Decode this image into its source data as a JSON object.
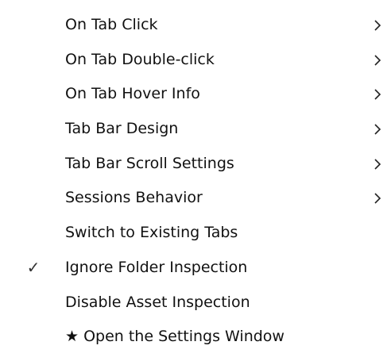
{
  "menu": {
    "items": [
      {
        "label": "On Tab Click",
        "submenu": true,
        "checked": false
      },
      {
        "label": "On Tab Double-click",
        "submenu": true,
        "checked": false
      },
      {
        "label": "On Tab Hover Info",
        "submenu": true,
        "checked": false
      },
      {
        "label": "Tab Bar Design",
        "submenu": true,
        "checked": false
      },
      {
        "label": "Tab Bar Scroll Settings",
        "submenu": true,
        "checked": false
      },
      {
        "label": "Sessions Behavior",
        "submenu": true,
        "checked": false
      },
      {
        "label": "Switch to Existing Tabs",
        "submenu": false,
        "checked": false
      },
      {
        "label": "Ignore Folder Inspection",
        "submenu": false,
        "checked": true,
        "check_glyph": "✓"
      },
      {
        "label": "Disable Asset Inspection",
        "submenu": false,
        "checked": false
      },
      {
        "label": "★ Open the Settings Window",
        "submenu": false,
        "checked": false
      }
    ]
  }
}
